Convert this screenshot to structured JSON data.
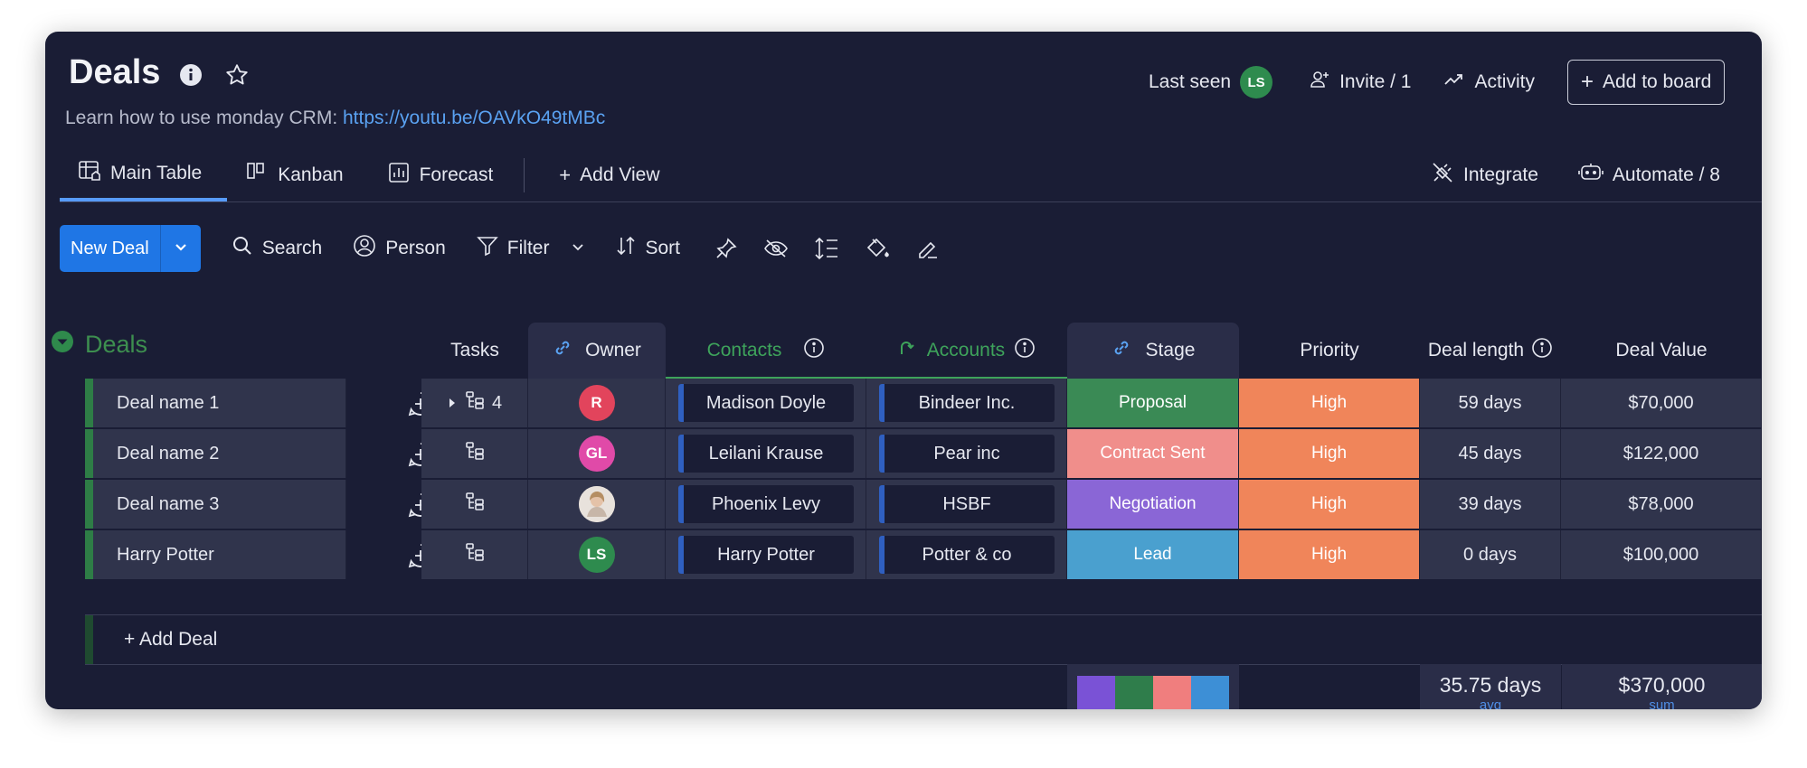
{
  "board": {
    "title": "Deals",
    "subtitle_text": "Learn how to use monday CRM: ",
    "subtitle_link": "https://youtu.be/OAVkO49tMBc"
  },
  "topbar": {
    "last_seen_label": "Last seen",
    "last_seen_initials": "LS",
    "invite_label": "Invite / 1",
    "activity_label": "Activity",
    "add_to_board_label": "Add to board"
  },
  "views": {
    "tabs": [
      {
        "label": "Main Table",
        "icon": "table-icon",
        "active": true
      },
      {
        "label": "Kanban",
        "icon": "kanban-icon",
        "active": false
      },
      {
        "label": "Forecast",
        "icon": "chart-icon",
        "active": false
      }
    ],
    "add_view_label": "Add View",
    "integrate_label": "Integrate",
    "automate_label": "Automate / 8"
  },
  "toolbar": {
    "new_deal_label": "New Deal",
    "search_label": "Search",
    "person_label": "Person",
    "filter_label": "Filter",
    "sort_label": "Sort"
  },
  "group": {
    "title": "Deals",
    "color": "#3d8f4f"
  },
  "columns": {
    "tasks": "Tasks",
    "owner": "Owner",
    "contacts": "Contacts",
    "accounts": "Accounts",
    "stage": "Stage",
    "priority": "Priority",
    "deal_length": "Deal length",
    "deal_value": "Deal Value"
  },
  "rows": [
    {
      "name": "Deal name 1",
      "tasks_count": "4",
      "owner_initials": "R",
      "owner_color": "#e2445c",
      "contact": "Madison Doyle",
      "account": "Bindeer Inc.",
      "stage": "Proposal",
      "stage_color": "#3a8a55",
      "priority": "High",
      "priority_color": "#f0855a",
      "deal_length": "59 days",
      "deal_value": "$70,000"
    },
    {
      "name": "Deal name 2",
      "tasks_count": "",
      "owner_initials": "GL",
      "owner_color": "#e04aa8",
      "contact": "Leilani Krause",
      "account": "Pear inc",
      "stage": "Contract Sent",
      "stage_color": "#f08e8b",
      "priority": "High",
      "priority_color": "#f0855a",
      "deal_length": "45 days",
      "deal_value": "$122,000"
    },
    {
      "name": "Deal name 3",
      "tasks_count": "",
      "owner_initials": "",
      "owner_color": "#d9c8bf",
      "contact": "Phoenix Levy",
      "account": "HSBF",
      "stage": "Negotiation",
      "stage_color": "#8a66d6",
      "priority": "High",
      "priority_color": "#f0855a",
      "deal_length": "39 days",
      "deal_value": "$78,000"
    },
    {
      "name": "Harry Potter",
      "tasks_count": "",
      "owner_initials": "LS",
      "owner_color": "#2e8b4e",
      "contact": "Harry Potter",
      "account": "Potter & co",
      "stage": "Lead",
      "stage_color": "#4aa0cf",
      "priority": "High",
      "priority_color": "#f0855a",
      "deal_length": "0 days",
      "deal_value": "$100,000"
    }
  ],
  "add_deal_label": "+ Add Deal",
  "summary": {
    "stage_distribution_colors": [
      "#7a52d6",
      "#2f7d4b",
      "#f07e7e",
      "#3d8fd6"
    ],
    "deal_length_value": "35.75 days",
    "deal_length_label": "avg",
    "deal_value_value": "$370,000",
    "deal_value_label": "sum"
  }
}
